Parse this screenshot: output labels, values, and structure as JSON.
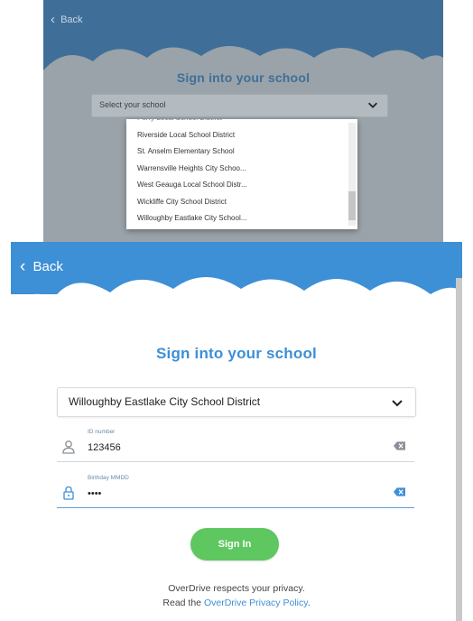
{
  "colors": {
    "header_blue": "#3d8fd6",
    "title_blue": "#3d8fd6",
    "signin_green": "#5ec760",
    "link_blue": "#3d8fd6",
    "dim_header": "#3f6f98"
  },
  "top_screen": {
    "back_label": "Back",
    "title": "Sign into your school",
    "select_placeholder": "Select your school",
    "dropdown_options": [
      "Perry Local School District",
      "Riverside Local School District",
      "St. Anselm Elementary School",
      "Warrensville Heights City Schoo...",
      "West Geauga Local School Distr...",
      "Wickliffe City School District",
      "Willoughby Eastlake City School..."
    ]
  },
  "bottom_screen": {
    "back_label": "Back",
    "title": "Sign into your school",
    "selected_school": "Willoughby Eastlake City School District",
    "id_field": {
      "label": "ID number",
      "value": "123456"
    },
    "birthday_field": {
      "label": "Birthday MMDD",
      "value": "••••"
    },
    "sign_in_label": "Sign In",
    "privacy_line1": "OverDrive respects your privacy.",
    "privacy_prefix": "Read the ",
    "privacy_link": "OverDrive Privacy Policy",
    "privacy_suffix": "."
  },
  "icons": {
    "back": "chevron-left-icon",
    "dropdown": "chevron-down-icon",
    "user": "user-icon",
    "lock": "lock-icon",
    "clear": "backspace-clear-icon"
  }
}
